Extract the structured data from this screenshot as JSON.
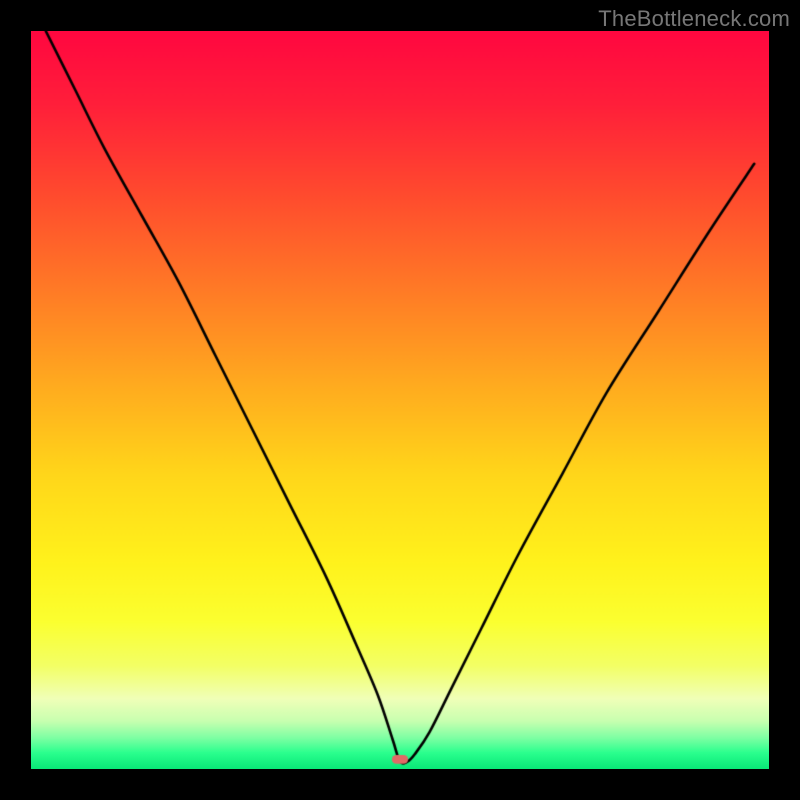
{
  "watermark": "TheBottleneck.com",
  "layout": {
    "canvas_size": 800,
    "plot_inset": 31
  },
  "chart_data": {
    "type": "line",
    "title": "",
    "xlabel": "",
    "ylabel": "",
    "xlim": [
      0,
      100
    ],
    "ylim": [
      0,
      100
    ],
    "series": [
      {
        "name": "bottleneck-curve",
        "x": [
          2,
          6,
          10,
          15,
          20,
          25,
          30,
          35,
          40,
          44,
          47,
          49,
          50,
          51,
          52,
          54,
          57,
          61,
          66,
          72,
          78,
          85,
          92,
          98
        ],
        "values": [
          100,
          92,
          84,
          75,
          66,
          56,
          46,
          36,
          26,
          17,
          10,
          4,
          1,
          1,
          2,
          5,
          11,
          19,
          29,
          40,
          51,
          62,
          73,
          82
        ]
      }
    ],
    "marker": {
      "x": 50,
      "y": 1.3,
      "width_x": 2.2,
      "height_y": 1.2,
      "color": "#e06a66"
    },
    "gradient_stops": [
      {
        "pos": 0.0,
        "color": "#ff0740"
      },
      {
        "pos": 0.1,
        "color": "#ff1f3a"
      },
      {
        "pos": 0.22,
        "color": "#ff4a2e"
      },
      {
        "pos": 0.35,
        "color": "#ff7a26"
      },
      {
        "pos": 0.48,
        "color": "#ffab1f"
      },
      {
        "pos": 0.6,
        "color": "#ffd61a"
      },
      {
        "pos": 0.72,
        "color": "#fff21c"
      },
      {
        "pos": 0.8,
        "color": "#fbff30"
      },
      {
        "pos": 0.86,
        "color": "#f3ff65"
      },
      {
        "pos": 0.905,
        "color": "#f0ffb8"
      },
      {
        "pos": 0.935,
        "color": "#c8ffb0"
      },
      {
        "pos": 0.958,
        "color": "#7dffa3"
      },
      {
        "pos": 0.978,
        "color": "#2bff8e"
      },
      {
        "pos": 1.0,
        "color": "#09e877"
      }
    ]
  }
}
